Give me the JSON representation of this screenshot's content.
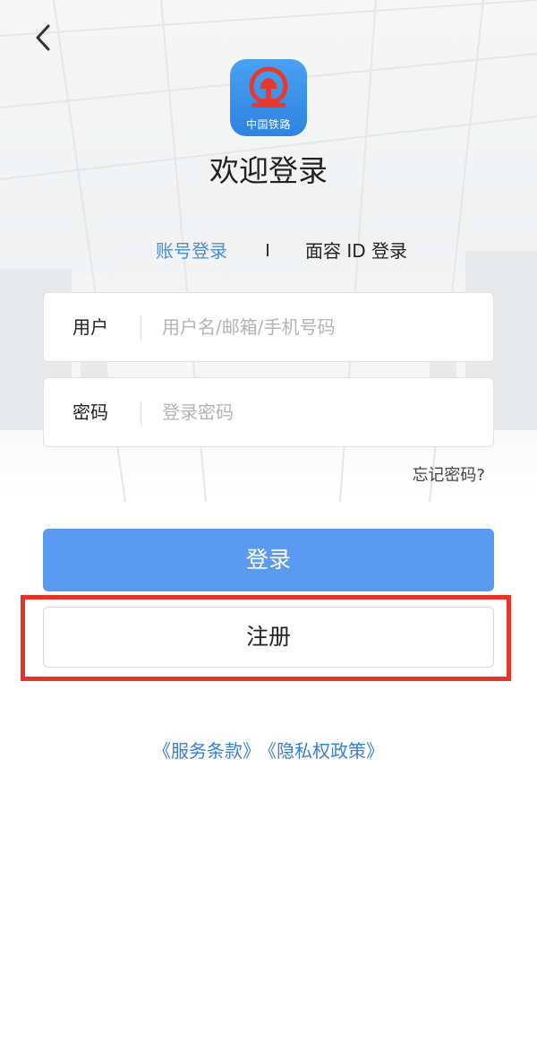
{
  "app": {
    "logo_text": "中国铁路",
    "welcome": "欢迎登录"
  },
  "tabs": {
    "account": "账号登录",
    "face": "面容 ID 登录",
    "active": "account"
  },
  "form": {
    "user_label": "用户",
    "user_placeholder": "用户名/邮箱/手机号码",
    "password_label": "密码",
    "password_placeholder": "登录密码",
    "forgot": "忘记密码?"
  },
  "buttons": {
    "login": "登录",
    "register": "注册"
  },
  "links": {
    "terms": "《服务条款》",
    "privacy": "《隐私权政策》"
  },
  "colors": {
    "accent": "#5a9af0",
    "link": "#3a7fd0",
    "logo_bg": "#2d83e0",
    "emblem_red": "#e63a2e",
    "highlight_red": "#e8332a"
  },
  "icons": {
    "back": "chevron-left-icon",
    "logo": "china-railway-emblem-icon"
  }
}
